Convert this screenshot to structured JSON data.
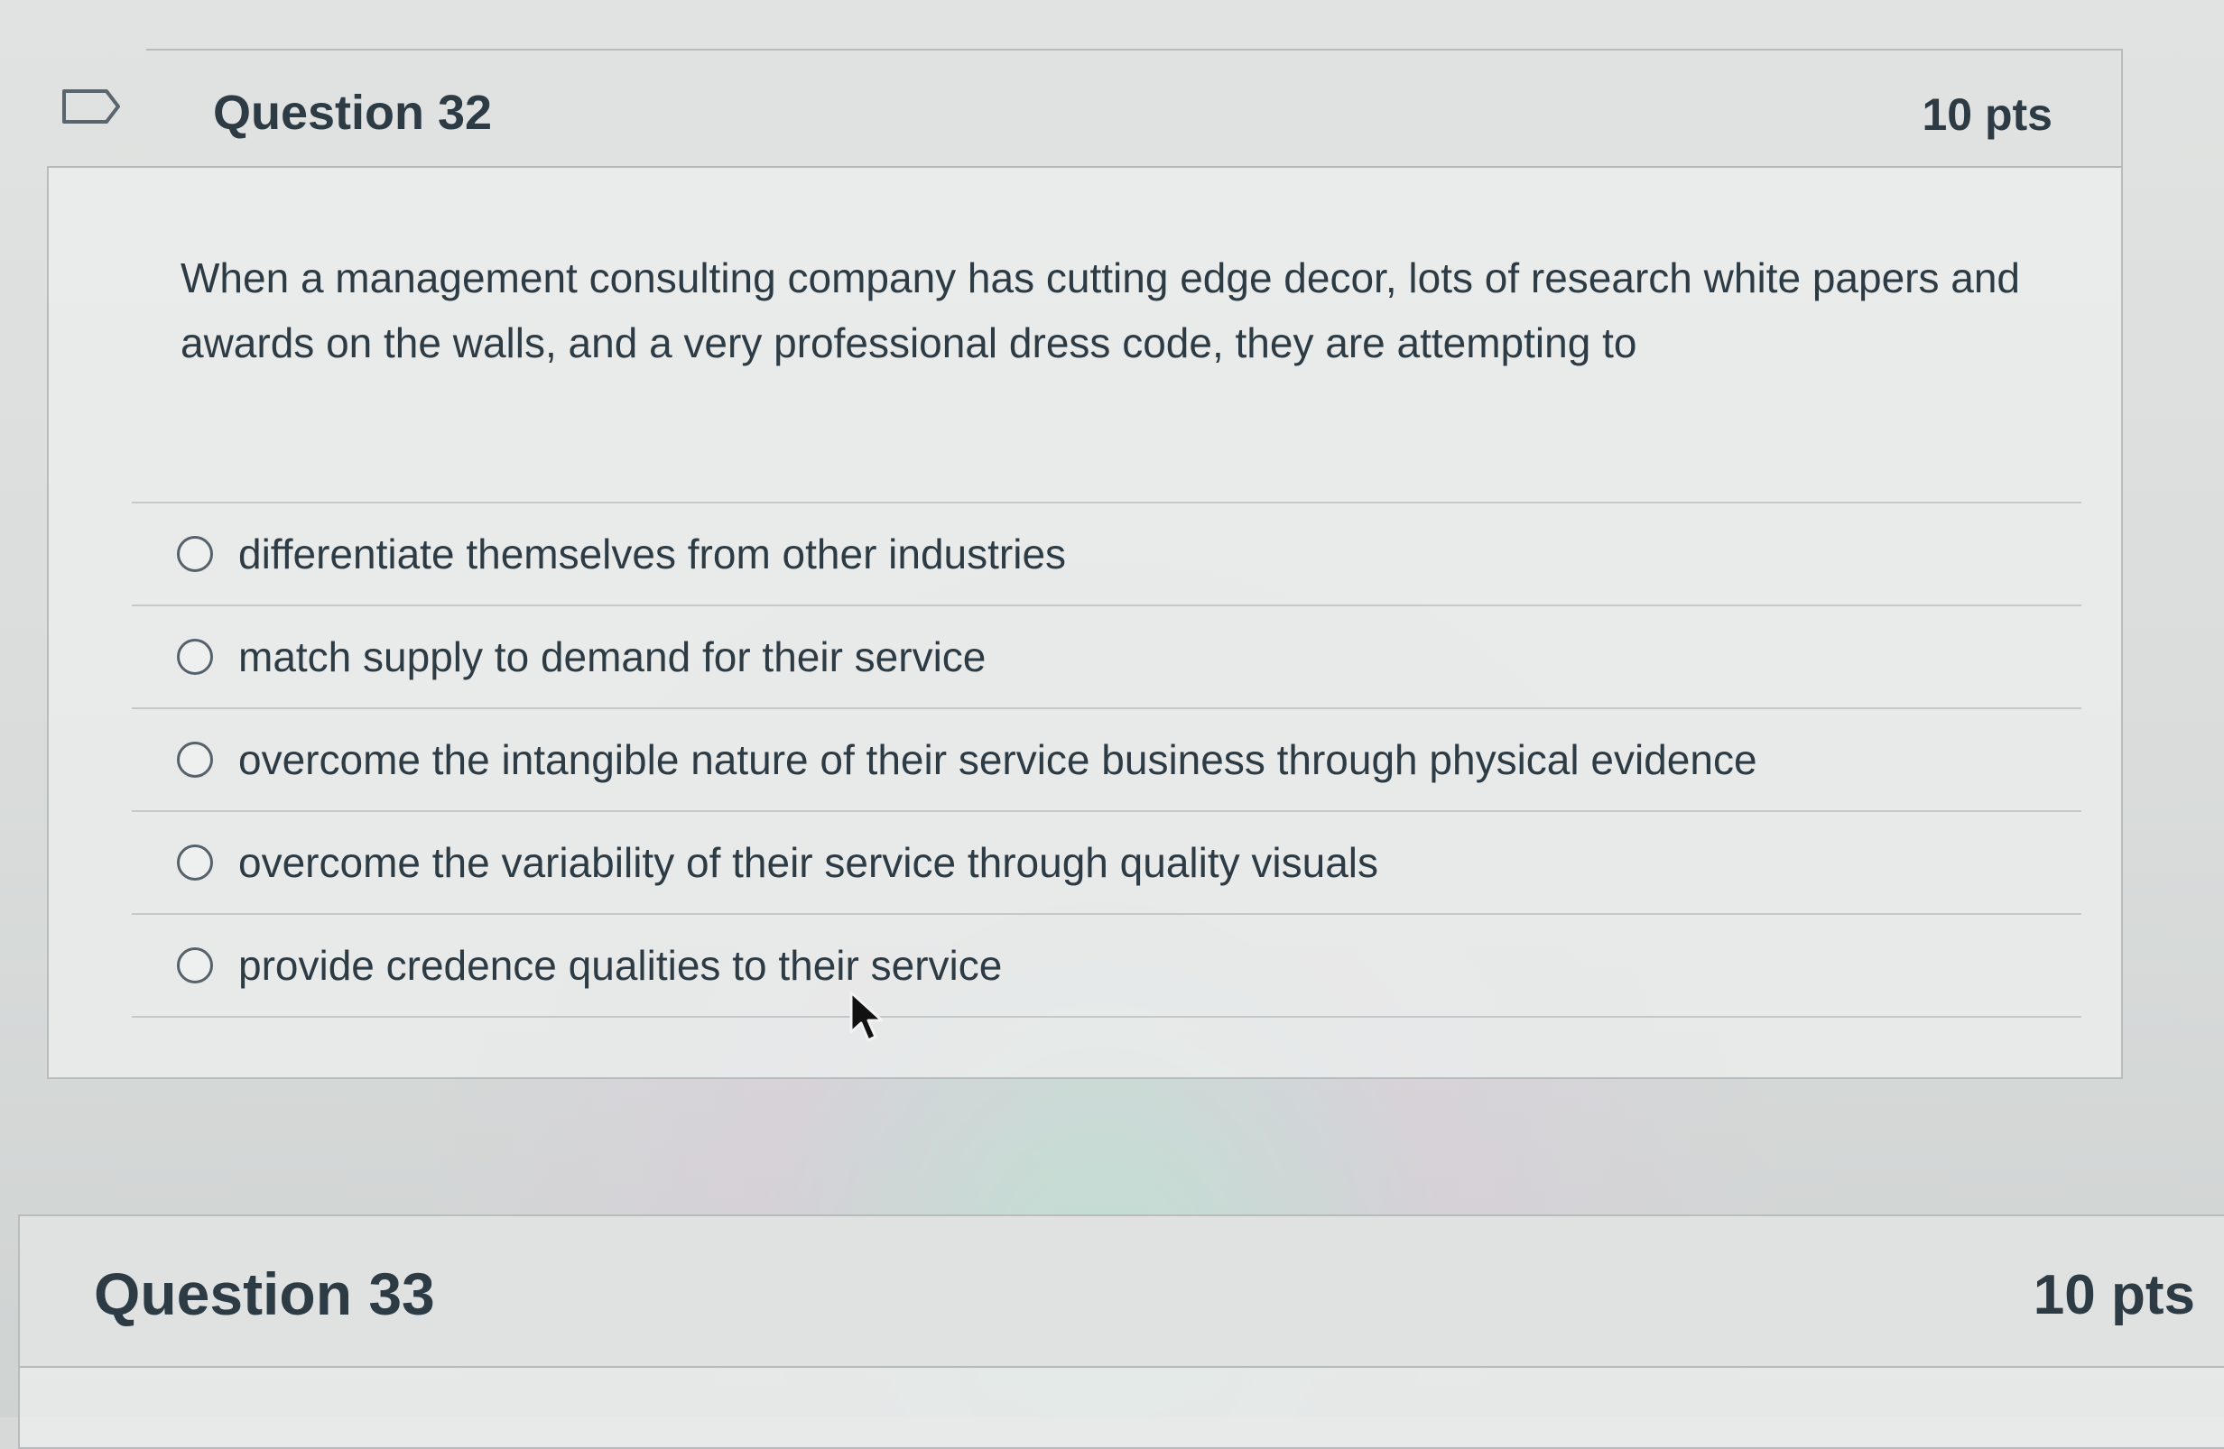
{
  "questions": [
    {
      "title": "Question 32",
      "points": "10 pts",
      "text": "When a management consulting company has cutting edge decor, lots of research white papers and awards on the walls, and a very professional dress code, they are attempting to",
      "answers": [
        "differentiate themselves from other industries",
        "match supply to demand for their service",
        "overcome the intangible nature of their service business through physical evidence",
        "overcome the variability of their service through quality visuals",
        "provide credence qualities to their service"
      ],
      "selected": null
    },
    {
      "title": "Question 33",
      "points": "10 pts"
    }
  ],
  "icons": {
    "flag": "bookmark-flag-icon",
    "pointer": "mouse-pointer-icon"
  },
  "colors": {
    "text": "#2d3b45",
    "border": "#b7bcbd",
    "header_bg": "#dee1e0"
  }
}
